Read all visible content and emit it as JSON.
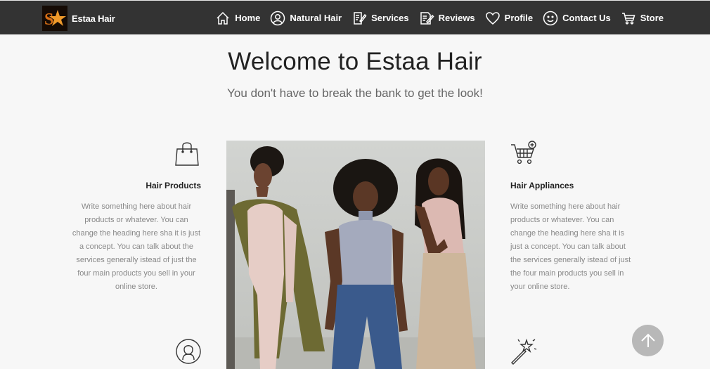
{
  "brand": {
    "name": "Estaa Hair",
    "logo_icon": "star-logo-icon"
  },
  "nav": {
    "items": [
      {
        "label": "Home",
        "icon": "home-icon"
      },
      {
        "label": "Natural Hair",
        "icon": "user-circle-icon"
      },
      {
        "label": "Services",
        "icon": "edit-document-icon"
      },
      {
        "label": "Reviews",
        "icon": "review-document-icon"
      },
      {
        "label": "Profile",
        "icon": "heart-icon"
      },
      {
        "label": "Contact Us",
        "icon": "smiley-icon"
      },
      {
        "label": "Store",
        "icon": "cart-icon"
      }
    ]
  },
  "hero": {
    "title": "Welcome to Estaa Hair",
    "subtitle": "You don't have to break the bank to get the look!"
  },
  "features": {
    "left": {
      "title": "Hair Products",
      "icon": "shopping-bag-icon",
      "text": "Write something here about hair products or whatever. You can change the heading here sha it is just a concept. You can talk about the services generally istead of just the four main products you sell in your online store."
    },
    "right": {
      "title": "Hair Appliances",
      "icon": "cart-add-icon",
      "text": "Write something here about hair products or whatever. You can change the heading here sha it is just a concept. You can talk about the services generally istead of just the four main products you sell in your online store."
    },
    "bottom_left_icon": "person-circle-icon",
    "bottom_right_icon": "magic-wand-icon"
  },
  "photo": {
    "icon": "hero-photo-three-women"
  },
  "back_to_top": {
    "icon": "arrow-up-icon"
  },
  "colors": {
    "navbar": "#333333",
    "background": "#f7f7f7",
    "accent_star": "#e07a1a",
    "back_to_top": "#b8b8b8"
  }
}
